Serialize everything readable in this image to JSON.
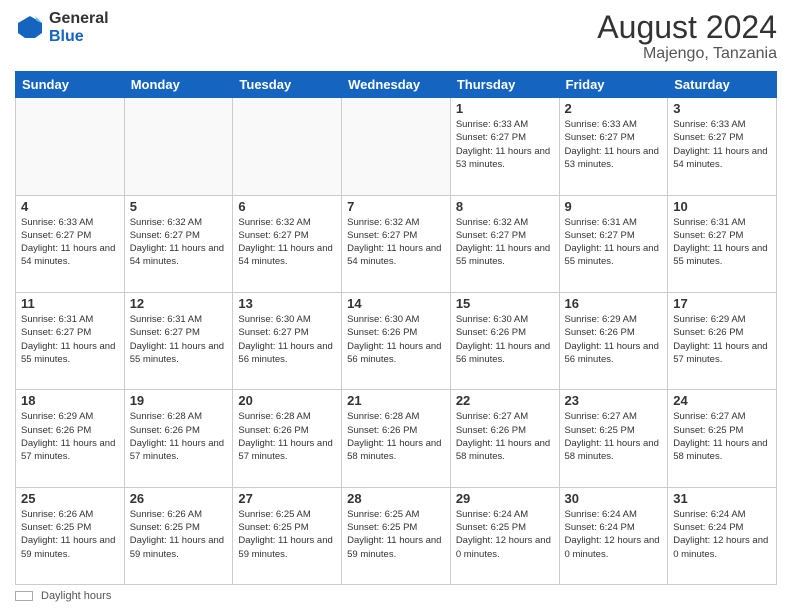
{
  "header": {
    "logo_line1": "General",
    "logo_line2": "Blue",
    "main_title": "August 2024",
    "sub_title": "Majengo, Tanzania"
  },
  "calendar": {
    "days_of_week": [
      "Sunday",
      "Monday",
      "Tuesday",
      "Wednesday",
      "Thursday",
      "Friday",
      "Saturday"
    ],
    "weeks": [
      [
        {
          "day": "",
          "info": ""
        },
        {
          "day": "",
          "info": ""
        },
        {
          "day": "",
          "info": ""
        },
        {
          "day": "",
          "info": ""
        },
        {
          "day": "1",
          "info": "Sunrise: 6:33 AM\nSunset: 6:27 PM\nDaylight: 11 hours\nand 53 minutes."
        },
        {
          "day": "2",
          "info": "Sunrise: 6:33 AM\nSunset: 6:27 PM\nDaylight: 11 hours\nand 53 minutes."
        },
        {
          "day": "3",
          "info": "Sunrise: 6:33 AM\nSunset: 6:27 PM\nDaylight: 11 hours\nand 54 minutes."
        }
      ],
      [
        {
          "day": "4",
          "info": "Sunrise: 6:33 AM\nSunset: 6:27 PM\nDaylight: 11 hours\nand 54 minutes."
        },
        {
          "day": "5",
          "info": "Sunrise: 6:32 AM\nSunset: 6:27 PM\nDaylight: 11 hours\nand 54 minutes."
        },
        {
          "day": "6",
          "info": "Sunrise: 6:32 AM\nSunset: 6:27 PM\nDaylight: 11 hours\nand 54 minutes."
        },
        {
          "day": "7",
          "info": "Sunrise: 6:32 AM\nSunset: 6:27 PM\nDaylight: 11 hours\nand 54 minutes."
        },
        {
          "day": "8",
          "info": "Sunrise: 6:32 AM\nSunset: 6:27 PM\nDaylight: 11 hours\nand 55 minutes."
        },
        {
          "day": "9",
          "info": "Sunrise: 6:31 AM\nSunset: 6:27 PM\nDaylight: 11 hours\nand 55 minutes."
        },
        {
          "day": "10",
          "info": "Sunrise: 6:31 AM\nSunset: 6:27 PM\nDaylight: 11 hours\nand 55 minutes."
        }
      ],
      [
        {
          "day": "11",
          "info": "Sunrise: 6:31 AM\nSunset: 6:27 PM\nDaylight: 11 hours\nand 55 minutes."
        },
        {
          "day": "12",
          "info": "Sunrise: 6:31 AM\nSunset: 6:27 PM\nDaylight: 11 hours\nand 55 minutes."
        },
        {
          "day": "13",
          "info": "Sunrise: 6:30 AM\nSunset: 6:27 PM\nDaylight: 11 hours\nand 56 minutes."
        },
        {
          "day": "14",
          "info": "Sunrise: 6:30 AM\nSunset: 6:26 PM\nDaylight: 11 hours\nand 56 minutes."
        },
        {
          "day": "15",
          "info": "Sunrise: 6:30 AM\nSunset: 6:26 PM\nDaylight: 11 hours\nand 56 minutes."
        },
        {
          "day": "16",
          "info": "Sunrise: 6:29 AM\nSunset: 6:26 PM\nDaylight: 11 hours\nand 56 minutes."
        },
        {
          "day": "17",
          "info": "Sunrise: 6:29 AM\nSunset: 6:26 PM\nDaylight: 11 hours\nand 57 minutes."
        }
      ],
      [
        {
          "day": "18",
          "info": "Sunrise: 6:29 AM\nSunset: 6:26 PM\nDaylight: 11 hours\nand 57 minutes."
        },
        {
          "day": "19",
          "info": "Sunrise: 6:28 AM\nSunset: 6:26 PM\nDaylight: 11 hours\nand 57 minutes."
        },
        {
          "day": "20",
          "info": "Sunrise: 6:28 AM\nSunset: 6:26 PM\nDaylight: 11 hours\nand 57 minutes."
        },
        {
          "day": "21",
          "info": "Sunrise: 6:28 AM\nSunset: 6:26 PM\nDaylight: 11 hours\nand 58 minutes."
        },
        {
          "day": "22",
          "info": "Sunrise: 6:27 AM\nSunset: 6:26 PM\nDaylight: 11 hours\nand 58 minutes."
        },
        {
          "day": "23",
          "info": "Sunrise: 6:27 AM\nSunset: 6:25 PM\nDaylight: 11 hours\nand 58 minutes."
        },
        {
          "day": "24",
          "info": "Sunrise: 6:27 AM\nSunset: 6:25 PM\nDaylight: 11 hours\nand 58 minutes."
        }
      ],
      [
        {
          "day": "25",
          "info": "Sunrise: 6:26 AM\nSunset: 6:25 PM\nDaylight: 11 hours\nand 59 minutes."
        },
        {
          "day": "26",
          "info": "Sunrise: 6:26 AM\nSunset: 6:25 PM\nDaylight: 11 hours\nand 59 minutes."
        },
        {
          "day": "27",
          "info": "Sunrise: 6:25 AM\nSunset: 6:25 PM\nDaylight: 11 hours\nand 59 minutes."
        },
        {
          "day": "28",
          "info": "Sunrise: 6:25 AM\nSunset: 6:25 PM\nDaylight: 11 hours\nand 59 minutes."
        },
        {
          "day": "29",
          "info": "Sunrise: 6:24 AM\nSunset: 6:25 PM\nDaylight: 12 hours\nand 0 minutes."
        },
        {
          "day": "30",
          "info": "Sunrise: 6:24 AM\nSunset: 6:24 PM\nDaylight: 12 hours\nand 0 minutes."
        },
        {
          "day": "31",
          "info": "Sunrise: 6:24 AM\nSunset: 6:24 PM\nDaylight: 12 hours\nand 0 minutes."
        }
      ]
    ]
  },
  "footer": {
    "swatch_label": "Daylight hours"
  }
}
